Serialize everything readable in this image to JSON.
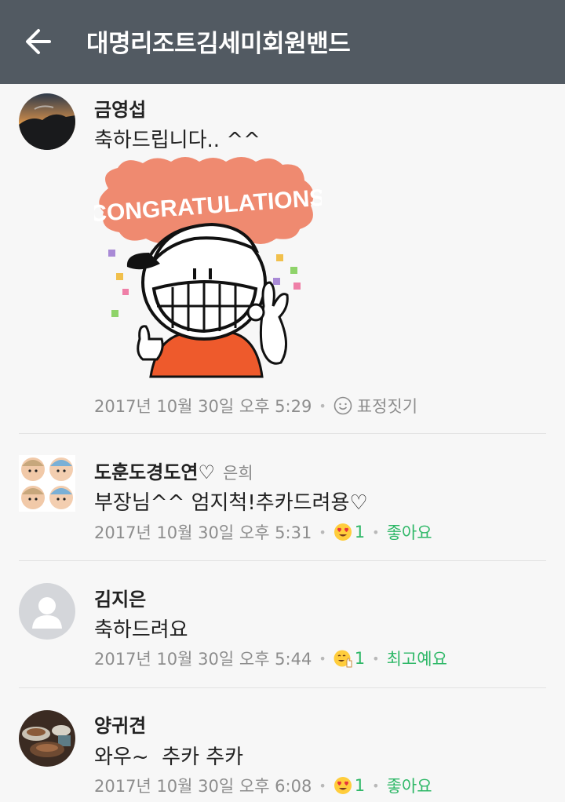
{
  "header": {
    "title": "대명리조트김세미회원밴드",
    "back_icon": "arrow-left-icon"
  },
  "colors": {
    "header_bg": "#525a62",
    "accent_green": "#2fb868",
    "background": "#f7f7f7"
  },
  "sticker": {
    "text": "CONGRATULATIONS"
  },
  "comments": [
    {
      "author": "금영섭",
      "text": "축하드립니다.. ^^",
      "timestamp": "2017년 10월 30일 오후 5:29",
      "action": "표정짓기",
      "action_icon": "smiley-outline-icon"
    },
    {
      "author": "도훈도경도연♡",
      "mention": "은희",
      "text": "부장님^^ 엄지척!추카드려용♡",
      "timestamp": "2017년 10월 30일 오후 5:31",
      "reaction_icon": "heart-eyes-emoji-icon",
      "reaction_count": "1",
      "action": "좋아요"
    },
    {
      "author": "김지은",
      "text": "축하드려요",
      "timestamp": "2017년 10월 30일 오후 5:44",
      "reaction_icon": "thumbs-up-emoji-icon",
      "reaction_count": "1",
      "action": "최고예요"
    },
    {
      "author": "양귀견",
      "text": "와우~  추카 추카",
      "timestamp": "2017년 10월 30일 오후 6:08",
      "reaction_icon": "heart-eyes-emoji-icon",
      "reaction_count": "1",
      "action": "좋아요"
    }
  ]
}
